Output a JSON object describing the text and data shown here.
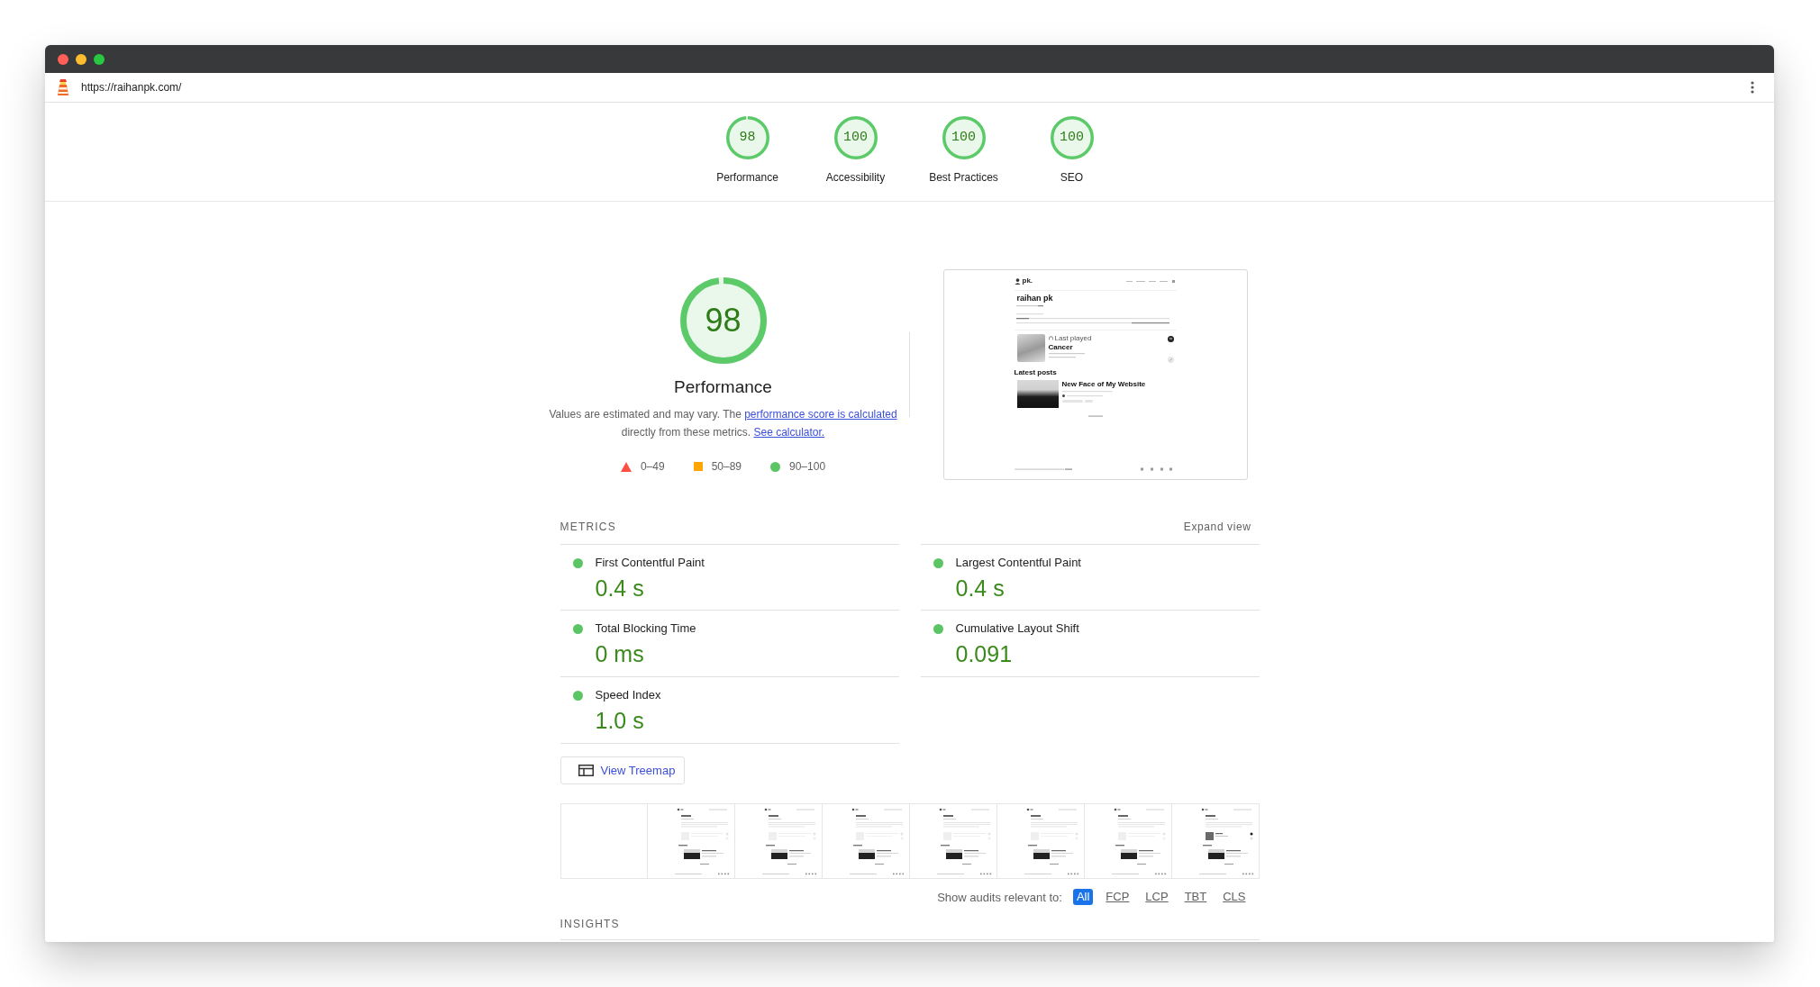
{
  "window": {
    "url": "https://raihanpk.com/"
  },
  "score_gauges": [
    {
      "score": "98",
      "label": "Performance",
      "level": 0.98
    },
    {
      "score": "100",
      "label": "Accessibility",
      "level": 1
    },
    {
      "score": "100",
      "label": "Best Practices",
      "level": 1
    },
    {
      "score": "100",
      "label": "SEO",
      "level": 1
    }
  ],
  "performance": {
    "score": "98",
    "level": 0.98,
    "title": "Performance",
    "description": [
      {
        "kind": "text",
        "text": "Values are estimated and may vary. The "
      },
      {
        "kind": "link",
        "text": "performance score is calculated"
      },
      {
        "kind": "text",
        "text": " directly from these metrics. "
      },
      {
        "kind": "link",
        "text": "See calculator."
      }
    ],
    "legend": [
      {
        "kind": "fail",
        "range": "0–49"
      },
      {
        "kind": "average",
        "range": "50–89"
      },
      {
        "kind": "pass",
        "range": "90–100"
      }
    ]
  },
  "final_screenshot": {
    "site_name": "pk.",
    "heading": "raihan pk",
    "now_playing_label": "Last played",
    "track": "Cancer",
    "section_title": "Latest posts",
    "post_title": "New Face of My Website"
  },
  "metrics": {
    "title": "METRICS",
    "expand_link": "Expand view",
    "items": [
      {
        "label": "First Contentful Paint",
        "value": "0.4 s",
        "color": "#5bc565"
      },
      {
        "label": "Largest Contentful Paint",
        "value": "0.4 s",
        "color": "#5bc565"
      },
      {
        "label": "Total Blocking Time",
        "value": "0 ms",
        "color": "#5bc565"
      },
      {
        "label": "Cumulative Layout Shift",
        "value": "0.091",
        "color": "#5bc565"
      },
      {
        "label": "Speed Index",
        "value": "1.0 s",
        "color": "#5bc565"
      }
    ]
  },
  "treemap_button": "View Treemap",
  "filmstrip": [
    {
      "kind": "blank"
    },
    {
      "kind": "partial"
    },
    {
      "kind": "partial"
    },
    {
      "kind": "partial"
    },
    {
      "kind": "partial"
    },
    {
      "kind": "partial"
    },
    {
      "kind": "partial"
    },
    {
      "kind": "complete"
    }
  ],
  "audit_filter": {
    "label": "Show audits relevant to:",
    "options": [
      {
        "label": "All",
        "selected": true
      },
      {
        "label": "FCP",
        "selected": false
      },
      {
        "label": "LCP",
        "selected": false
      },
      {
        "label": "TBT",
        "selected": false
      },
      {
        "label": "CLS",
        "selected": false
      }
    ]
  },
  "insights": {
    "title": "INSIGHTS"
  }
}
